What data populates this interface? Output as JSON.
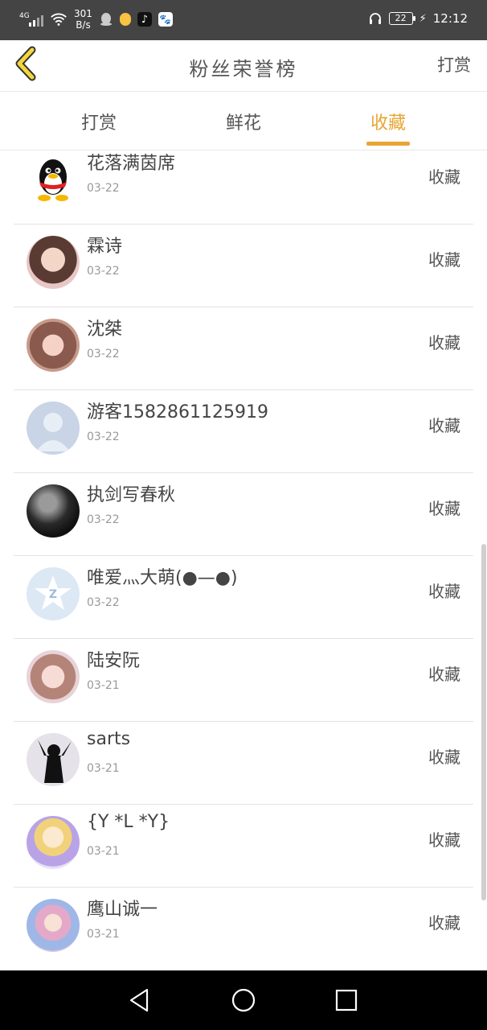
{
  "status_bar": {
    "network": "4G",
    "speed": "301",
    "speed_unit": "B/s",
    "battery": "22",
    "time": "12:12"
  },
  "header": {
    "title": "粉丝荣誉榜",
    "right_label": "打赏"
  },
  "tabs": [
    {
      "label": "打赏",
      "active": false
    },
    {
      "label": "鲜花",
      "active": false
    },
    {
      "label": "收藏",
      "active": true
    }
  ],
  "accent_color": "#e8a534",
  "fans": [
    {
      "name": "花落满茵席",
      "date": "03-22",
      "action": "收藏",
      "avatar": "qq-penguin"
    },
    {
      "name": "霖诗",
      "date": "03-22",
      "action": "收藏",
      "avatar": "girl-photo"
    },
    {
      "name": "沈桀",
      "date": "03-22",
      "action": "收藏",
      "avatar": "girl-photo"
    },
    {
      "name": "游客1582861125919",
      "date": "03-22",
      "action": "收藏",
      "avatar": "default-user"
    },
    {
      "name": "执剑写春秋",
      "date": "03-22",
      "action": "收藏",
      "avatar": "dark-photo"
    },
    {
      "name": "唯爱灬大萌(●—●)",
      "date": "03-22",
      "action": "收藏",
      "avatar": "qzone-star"
    },
    {
      "name": "陆安阮",
      "date": "03-21",
      "action": "收藏",
      "avatar": "girl-photo"
    },
    {
      "name": "sarts",
      "date": "03-21",
      "action": "收藏",
      "avatar": "silhouette"
    },
    {
      "name": "{Y *L *Y}",
      "date": "03-21",
      "action": "收藏",
      "avatar": "anime"
    },
    {
      "name": "鹰山诚一",
      "date": "03-21",
      "action": "收藏",
      "avatar": "anime"
    }
  ]
}
